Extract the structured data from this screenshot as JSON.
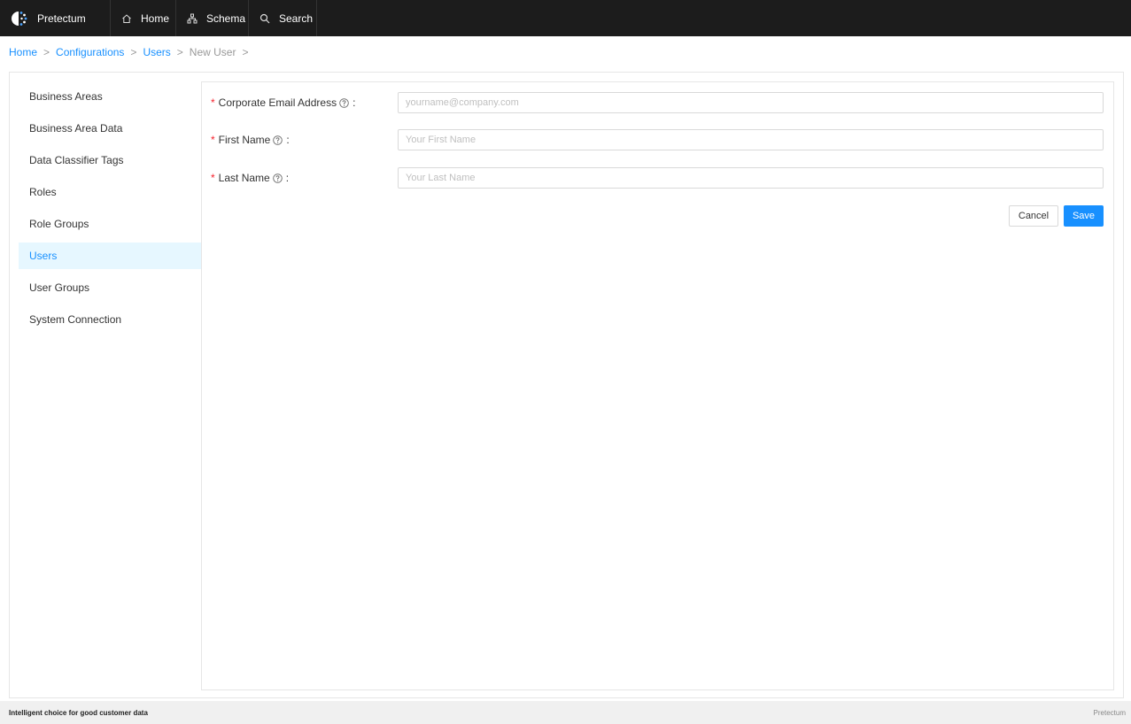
{
  "header": {
    "brand": "Pretectum",
    "nav": [
      {
        "label": "Home",
        "icon": "home-icon"
      },
      {
        "label": "Schema",
        "icon": "schema-icon"
      },
      {
        "label": "Search",
        "icon": "search-icon"
      }
    ]
  },
  "breadcrumb": [
    "Home",
    "Configurations",
    "Users",
    "New User"
  ],
  "sidebar": {
    "items": [
      {
        "label": "Business Areas"
      },
      {
        "label": "Business Area Data"
      },
      {
        "label": "Data Classifier Tags"
      },
      {
        "label": "Roles"
      },
      {
        "label": "Role Groups"
      },
      {
        "label": "Users",
        "active": true
      },
      {
        "label": "User Groups"
      },
      {
        "label": "System Connection"
      }
    ]
  },
  "form": {
    "email": {
      "label": "Corporate Email Address",
      "placeholder": "yourname@company.com",
      "value": ""
    },
    "first_name": {
      "label": "First Name",
      "placeholder": "Your First Name",
      "value": ""
    },
    "last_name": {
      "label": "Last Name",
      "placeholder": "Your Last Name",
      "value": ""
    },
    "required_mark": "*",
    "colon": ":",
    "cancel_label": "Cancel",
    "save_label": "Save"
  },
  "footer": {
    "tagline": "Intelligent choice for good customer data",
    "brand": "Pretectum"
  },
  "colors": {
    "topbar": "#1c1c1c",
    "accent": "#1890ff",
    "active_bg": "#e6f7ff",
    "required": "#f5222d"
  }
}
